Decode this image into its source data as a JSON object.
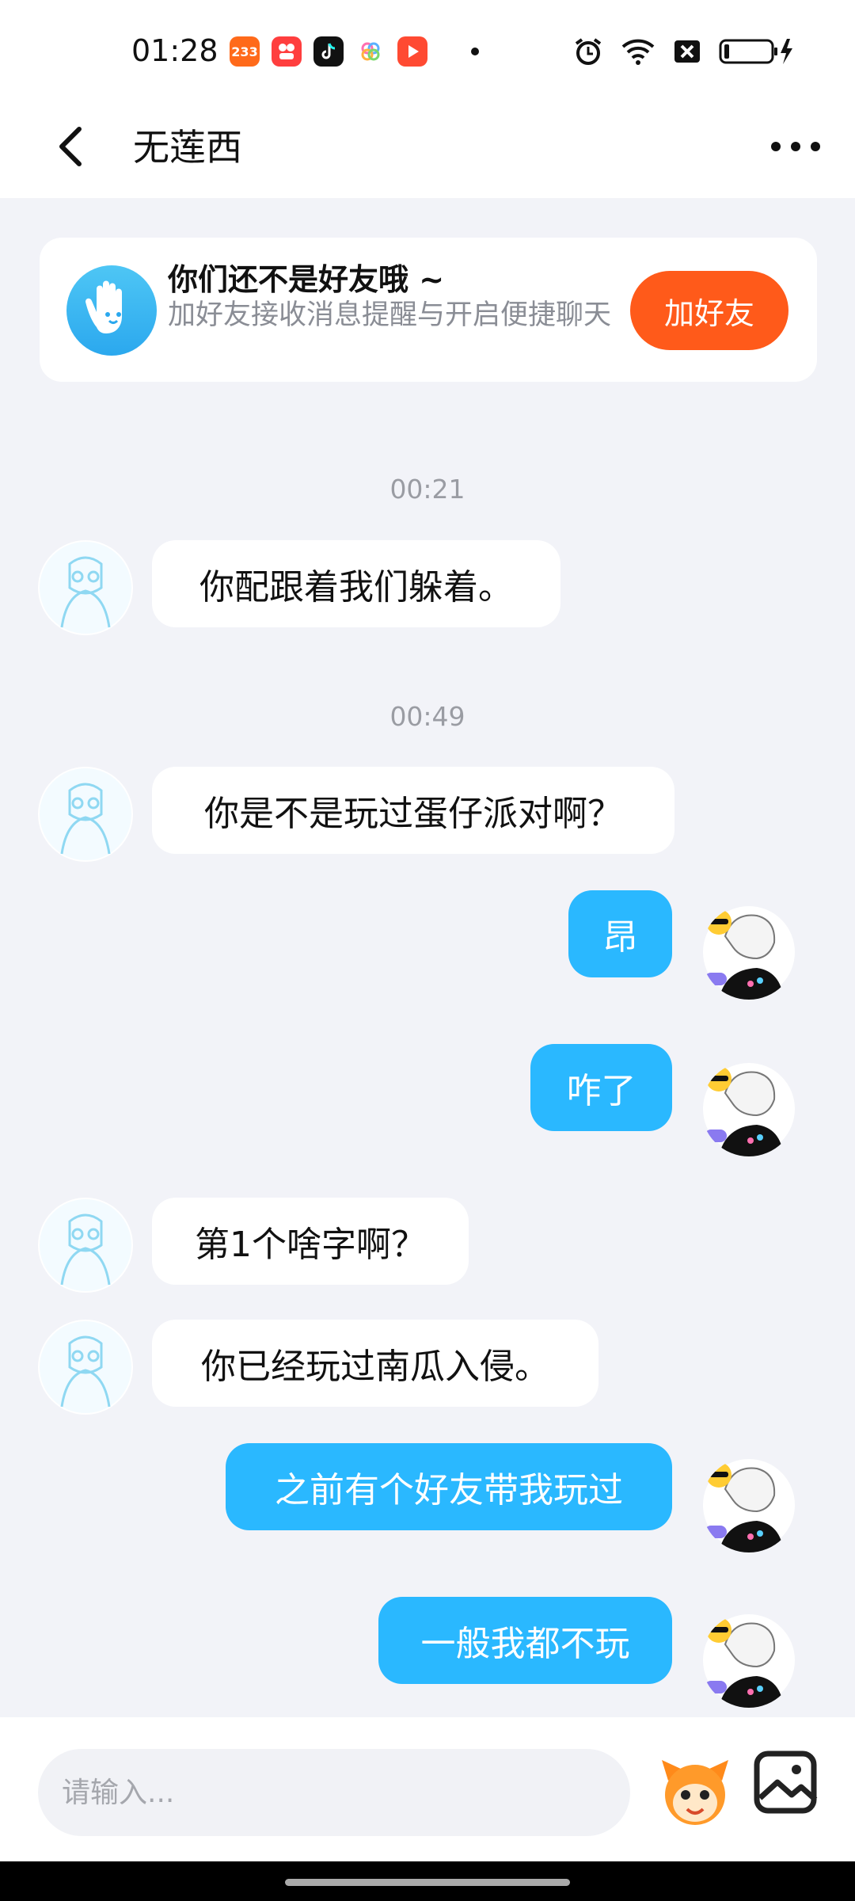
{
  "status": {
    "time": "01:28",
    "apps": [
      {
        "icon": "233-app-icon",
        "color": "#ff6a1a",
        "label": "233"
      },
      {
        "icon": "shop-app-icon",
        "color": "#ff3e3e",
        "label": ""
      },
      {
        "icon": "tiktok-icon",
        "color": "#111111",
        "label": ""
      },
      {
        "icon": "flower-app-icon",
        "color": "#ffffff",
        "label": ""
      },
      {
        "icon": "video-app-icon",
        "color": "#ff4a32",
        "label": ""
      }
    ]
  },
  "header": {
    "title": "无莲西"
  },
  "friend_card": {
    "title": "你们还不是好友哦 ~",
    "subtitle": "加好友接收消息提醒与开启便捷聊天",
    "button": "加好友"
  },
  "timestamps": [
    "00:21",
    "00:49"
  ],
  "messages": [
    {
      "side": "left",
      "text": "你配跟着我们躲着。"
    },
    {
      "side": "left",
      "text": "你是不是玩过蛋仔派对啊？"
    },
    {
      "side": "right",
      "text": "昂"
    },
    {
      "side": "right",
      "text": "咋了"
    },
    {
      "side": "left",
      "text": "第1个啥字啊？"
    },
    {
      "side": "left",
      "text": "你已经玩过南瓜入侵。"
    },
    {
      "side": "right",
      "text": "之前有个好友带我玩过"
    },
    {
      "side": "right",
      "text": "一般我都不玩"
    }
  ],
  "input": {
    "placeholder": "请输入..."
  },
  "colors": {
    "accent": "#2ab8ff",
    "add_button": "#ff5a1a",
    "background": "#f2f3f8"
  }
}
